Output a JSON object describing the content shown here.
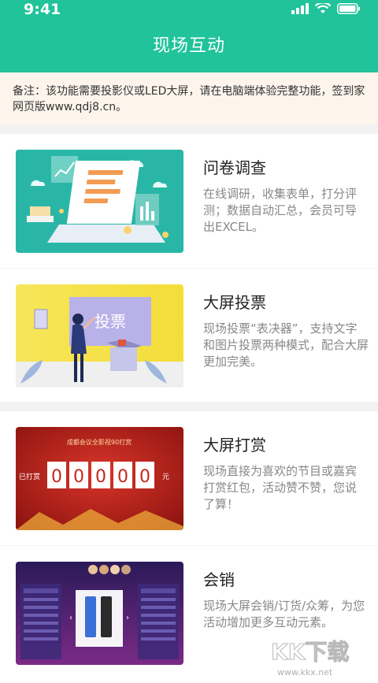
{
  "status": {
    "time": "9:41"
  },
  "header": {
    "title": "现场互动"
  },
  "notice": {
    "lines": [
      "备注：该功能需要投影仪或LED大屏，请在电脑端体验完整功能，签到家",
      "网页版www.qdj8.cn。"
    ]
  },
  "cards": [
    {
      "title": "问卷调查",
      "desc": [
        "在线调研，收集表单，打分评",
        "测；数据自动汇总，会员可导",
        "出EXCEL。"
      ]
    },
    {
      "title": "大屏投票",
      "desc": [
        "现场投票“表决器”，支持文字",
        "和图片投票两种模式，配合大屏",
        "更加完美。"
      ],
      "img_label": "投票"
    },
    {
      "title": "大屏打赏",
      "desc": [
        "现场直接为喜欢的节目或嘉宾",
        "打赏红包，活动赞不赞，您说",
        "了算！"
      ],
      "img_top": "成都会议全影视90打赏",
      "img_left": "已打赏",
      "img_right": "元",
      "digits": [
        "0",
        "0",
        "0",
        "0",
        "0"
      ]
    },
    {
      "title": "会销",
      "desc": [
        "现场大屏会销/订货/众筹，为您",
        "活动增加更多互动元素。"
      ]
    }
  ],
  "watermark": {
    "brand": "KK下载",
    "url": "www.kkx.net"
  },
  "colors": {
    "header": "#20c39a",
    "notice_bg": "#fdf5ec",
    "reward_red": "#c9251c",
    "vote_yellow": "#f6e65a"
  }
}
